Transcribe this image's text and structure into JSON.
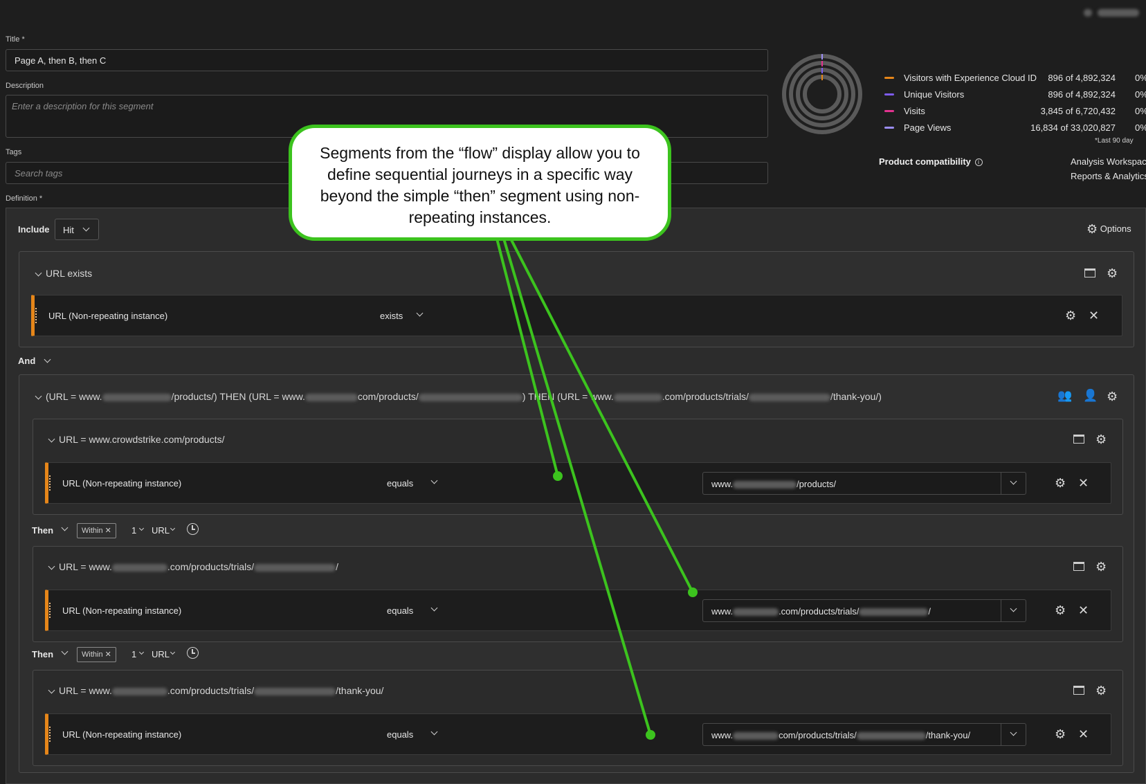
{
  "form": {
    "title_label": "Title",
    "title_value": "Page A, then B, then C",
    "description_label": "Description",
    "description_placeholder": "Enter a description for this segment",
    "tags_label": "Tags",
    "tags_placeholder": "Search tags",
    "definition_label": "Definition",
    "required_mark": "*"
  },
  "summary": {
    "legend": [
      {
        "label": "Visitors with Experience Cloud ID",
        "value": "896 of 4,892,324",
        "pct": "0%",
        "color": "#e68619"
      },
      {
        "label": "Unique Visitors",
        "value": "896 of 4,892,324",
        "pct": "0%",
        "color": "#7e5cf0"
      },
      {
        "label": "Visits",
        "value": "3,845 of 6,720,432",
        "pct": "0%",
        "color": "#e3338f"
      },
      {
        "label": "Page Views",
        "value": "16,834 of 33,020,827",
        "pct": "0%",
        "color": "#9b8df5"
      }
    ],
    "footnote": "*Last 90 day",
    "compat_label": "Product compatibility",
    "compat_values": [
      "Analysis Workspace",
      "Reports & Analytics"
    ]
  },
  "definition": {
    "include_label": "Include",
    "scope": "Hit",
    "options_label": "Options",
    "container1": {
      "title": "URL exists",
      "rule": {
        "dimension": "URL (Non-repeating instance)",
        "operator": "exists"
      }
    },
    "and_label": "And",
    "sequence": {
      "title_parts": [
        "(URL = www.",
        "/products/) THEN (URL = www.",
        "com/products/",
        ") THEN (URL = www.",
        ".com/products/trials/",
        "/thank-you/)"
      ],
      "steps": [
        {
          "title": "URL = www.crowdstrike.com/products/",
          "title_parts": [
            "URL = www.crowdstrike.com/products/"
          ],
          "dimension": "URL (Non-repeating instance)",
          "operator": "equals",
          "value_parts": [
            "www.",
            "/products/"
          ]
        },
        {
          "title_parts": [
            "URL = www.",
            ".com/products/trials/",
            "/"
          ],
          "dimension": "URL (Non-repeating instance)",
          "operator": "equals",
          "value_parts": [
            "www.",
            ".com/products/trials/",
            "/"
          ]
        },
        {
          "title_parts": [
            "URL = www.",
            ".com/products/trials/",
            "/thank-you/"
          ],
          "dimension": "URL (Non-repeating instance)",
          "operator": "equals",
          "value_parts": [
            "www.",
            "com/products/trials/",
            "/thank-you/"
          ]
        }
      ],
      "then": {
        "label": "Then",
        "within": "Within",
        "count": "1",
        "unit": "URL"
      }
    }
  },
  "callout": {
    "text": "Segments from the “flow” display allow you to define sequential journeys in a specific way beyond the simple “then” segment using non-repeating instances."
  }
}
